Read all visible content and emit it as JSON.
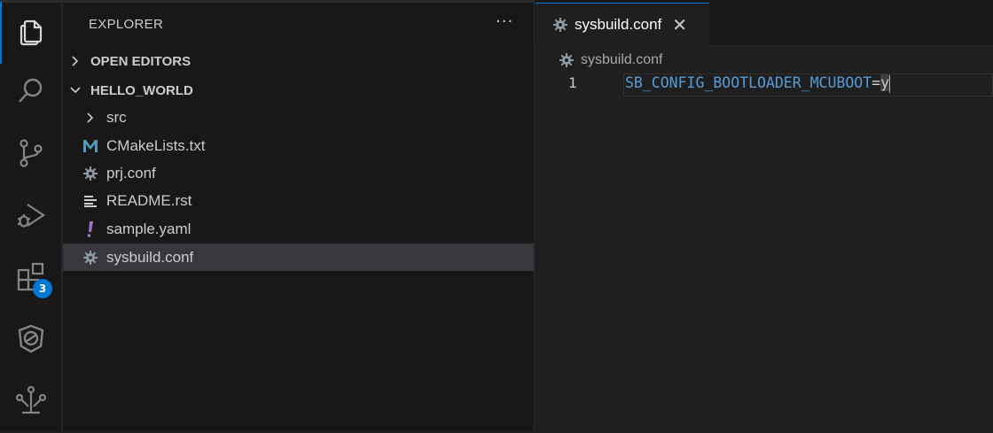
{
  "activity_bar": {
    "items": [
      {
        "icon": "files-icon",
        "active": true
      },
      {
        "icon": "search-icon"
      },
      {
        "icon": "source-control-icon"
      },
      {
        "icon": "run-debug-icon"
      },
      {
        "icon": "extensions-icon",
        "badge": "3"
      },
      {
        "icon": "nrf-connect-icon"
      },
      {
        "icon": "device-tree-icon"
      }
    ],
    "extensions_badge": "3",
    "accent": "#0078d4"
  },
  "sidebar": {
    "title": "EXPLORER",
    "more": "···",
    "open_editors_label": "OPEN EDITORS",
    "workspace_label": "HELLO_WORLD",
    "items": [
      {
        "label": "src",
        "icon": "chevron-right-icon"
      },
      {
        "label": "CMakeLists.txt",
        "icon": "cmake-m-icon"
      },
      {
        "label": "prj.conf",
        "icon": "gear-icon"
      },
      {
        "label": "README.rst",
        "icon": "lines-icon"
      },
      {
        "label": "sample.yaml",
        "icon": "exclamation-icon"
      },
      {
        "label": "sysbuild.conf",
        "icon": "gear-icon",
        "selected": true
      }
    ]
  },
  "editor": {
    "tab_label": "sysbuild.conf",
    "tab_close": "✕",
    "breadcrumb": "sysbuild.conf",
    "line_number": "1",
    "code_key": "SB_CONFIG_BOOTLOADER_MCUBOOT",
    "code_eq": "=",
    "code_val": "y"
  },
  "colors": {
    "background": "#1f1f1f",
    "sidebar": "#181818",
    "selection": "#37373d",
    "key": "#569cd6",
    "cmake": "#519aba",
    "yaml": "#a074c4"
  }
}
